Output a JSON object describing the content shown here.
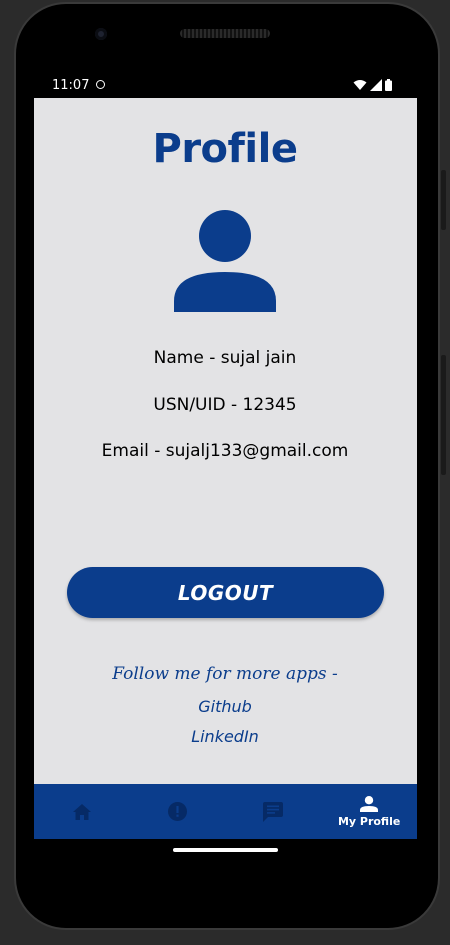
{
  "status_bar": {
    "time": "11:07"
  },
  "profile": {
    "title": "Profile",
    "name_line": "Name - sujal jain",
    "usn_line": "USN/UID - 12345",
    "email_line": "Email - sujalj133@gmail.com"
  },
  "actions": {
    "logout_label": "LOGOUT"
  },
  "footer": {
    "follow_text": "Follow me for more apps -",
    "github_label": "Github",
    "linkedin_label": "LinkedIn"
  },
  "bottom_nav": {
    "items": [
      {
        "icon": "home-icon",
        "label": ""
      },
      {
        "icon": "alert-icon",
        "label": ""
      },
      {
        "icon": "chat-icon",
        "label": ""
      },
      {
        "icon": "person-icon",
        "label": "My Profile"
      }
    ]
  },
  "colors": {
    "primary": "#0b3d8c",
    "background": "#e3e3e5",
    "text": "#000000",
    "nav_icon": "#062a66"
  }
}
